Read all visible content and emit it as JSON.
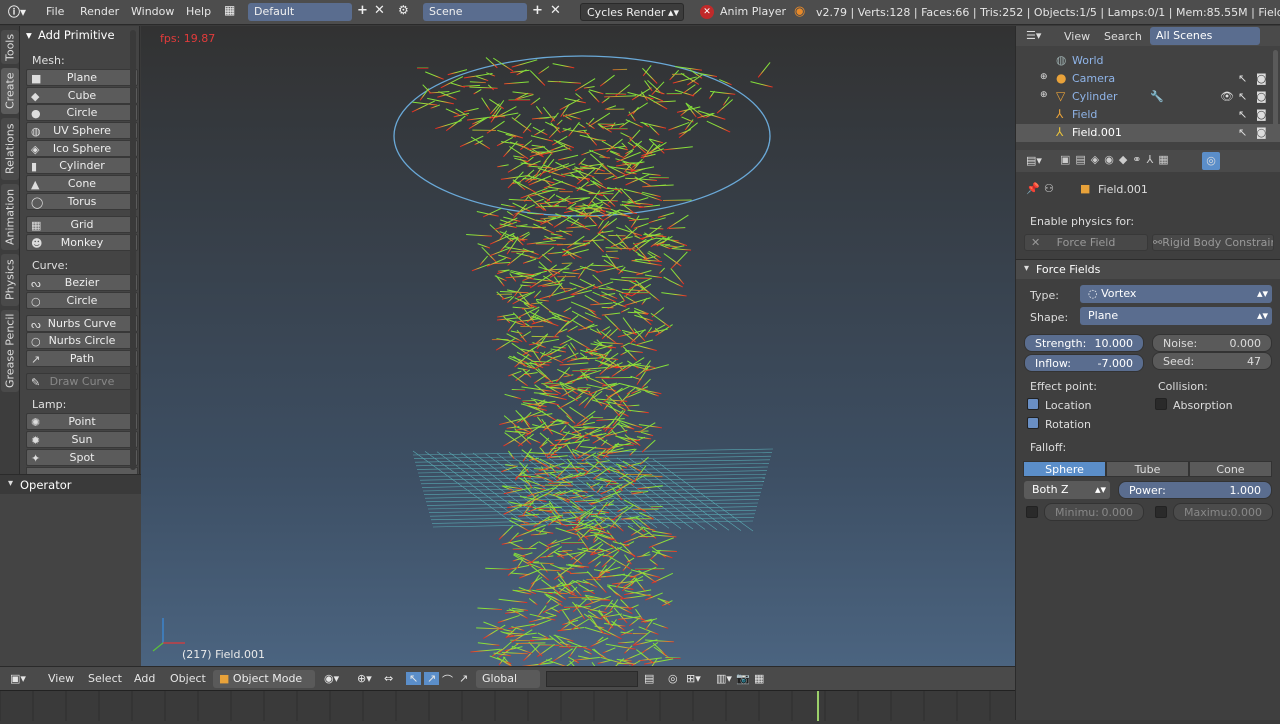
{
  "topbar": {
    "menus": [
      "File",
      "Render",
      "Window",
      "Help"
    ],
    "layout": "Default",
    "scene": "Scene",
    "engine": "Cycles Render",
    "anim_player": "Anim Player",
    "stats": "v2.79 | Verts:128 | Faces:66 | Tris:252 | Objects:1/5 | Lamps:0/1 | Mem:85.55M | Field.001"
  },
  "vtabs": [
    "Tools",
    "Create",
    "Relations",
    "Animation",
    "Physics",
    "Grease Pencil"
  ],
  "tools": {
    "title": "Add Primitive",
    "mesh_label": "Mesh:",
    "mesh": [
      "Plane",
      "Cube",
      "Circle",
      "UV Sphere",
      "Ico Sphere",
      "Cylinder",
      "Cone",
      "Torus"
    ],
    "mesh2": [
      "Grid",
      "Monkey"
    ],
    "curve_label": "Curve:",
    "curve": [
      "Bezier",
      "Circle"
    ],
    "curve2": [
      "Nurbs Curve",
      "Nurbs Circle",
      "Path"
    ],
    "draw_curve": "Draw Curve",
    "lamp_label": "Lamp:",
    "lamp": [
      "Point",
      "Sun",
      "Spot"
    ]
  },
  "operator": "Operator",
  "viewport": {
    "fps": "fps: 19.87",
    "object_label": "(217) Field.001"
  },
  "view_toolbar": {
    "menus": [
      "View",
      "Select",
      "Add",
      "Object"
    ],
    "mode": "Object Mode",
    "orientation": "Global"
  },
  "outliner": {
    "view": "View",
    "search": "Search",
    "filter": "All Scenes",
    "items": [
      "World",
      "Camera",
      "Cylinder",
      "Field",
      "Field.001"
    ]
  },
  "properties": {
    "object_name": "Field.001",
    "enable_physics": "Enable physics for:",
    "force_field_btn": "Force Field",
    "rigid_body_btn": "Rigid Body Constraint",
    "panel_title": "Force Fields",
    "type_label": "Type:",
    "type_value": "Vortex",
    "shape_label": "Shape:",
    "shape_value": "Plane",
    "strength_label": "Strength:",
    "strength_value": "10.000",
    "noise_label": "Noise:",
    "noise_value": "0.000",
    "inflow_label": "Inflow:",
    "inflow_value": "-7.000",
    "seed_label": "Seed:",
    "seed_value": "47",
    "effect_point": "Effect point:",
    "location": "Location",
    "rotation": "Rotation",
    "collision": "Collision:",
    "absorption": "Absorption",
    "falloff": "Falloff:",
    "falloff_tabs": [
      "Sphere",
      "Tube",
      "Cone"
    ],
    "both_z": "Both Z",
    "power_label": "Power:",
    "power_value": "1.000",
    "minimum_label": "Minimu:",
    "minimum_value": "0.000",
    "maximum_label": "Maximu:",
    "maximum_value": "0.000"
  }
}
